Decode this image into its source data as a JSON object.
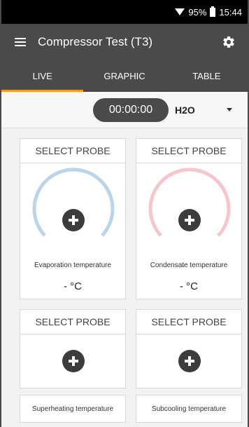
{
  "status_bar": {
    "battery": "95%",
    "time": "15:44"
  },
  "app_bar": {
    "title": "Compressor Test (T3)"
  },
  "tabs": [
    {
      "label": "LIVE",
      "active": true
    },
    {
      "label": "GRAPHIC",
      "active": false
    },
    {
      "label": "TABLE",
      "active": false
    }
  ],
  "controls": {
    "timer": "00:00:00",
    "medium": "H2O"
  },
  "cards": [
    {
      "header": "SELECT PROBE",
      "label": "Evaporation temperature",
      "value": "- °C",
      "gauge_color": "#b9d5ea"
    },
    {
      "header": "SELECT PROBE",
      "label": "Condensate temperature",
      "value": "- °C",
      "gauge_color": "#f6c6cc"
    },
    {
      "header": "SELECT PROBE"
    },
    {
      "header": "SELECT PROBE"
    }
  ],
  "bottom_labels": [
    "Superheating temperature",
    "Subcooling temperature"
  ],
  "colors": {
    "app_bar": "#4a4a4a",
    "tab_indicator": "#f29a1f",
    "plus_button": "#3c3c3c"
  }
}
